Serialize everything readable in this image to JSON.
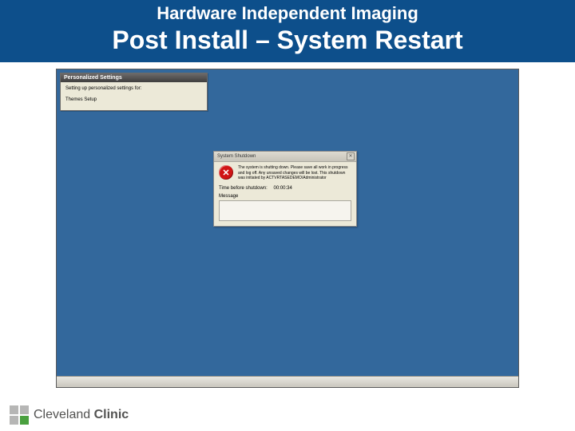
{
  "header": {
    "line1": "Hardware Independent Imaging",
    "line2": "Post Install – System Restart"
  },
  "personalized_settings": {
    "title": "Personalized Settings",
    "msg1": "Setting up personalized settings for:",
    "msg2": "Themes Setup"
  },
  "shutdown_dialog": {
    "title": "System Shutdown",
    "close_glyph": "✕",
    "error_glyph": "✕",
    "body_text": "The system is shutting down. Please save all work in progress and log off. Any unsaved changes will be lost. This shutdown was initiated by ACTVRTASEDEMO\\Administrator",
    "countdown_label": "Time before shutdown:",
    "countdown_value": "00:00:34",
    "message_label": "Message"
  },
  "footer": {
    "brand1": "Cleveland",
    "brand2": "Clinic"
  }
}
